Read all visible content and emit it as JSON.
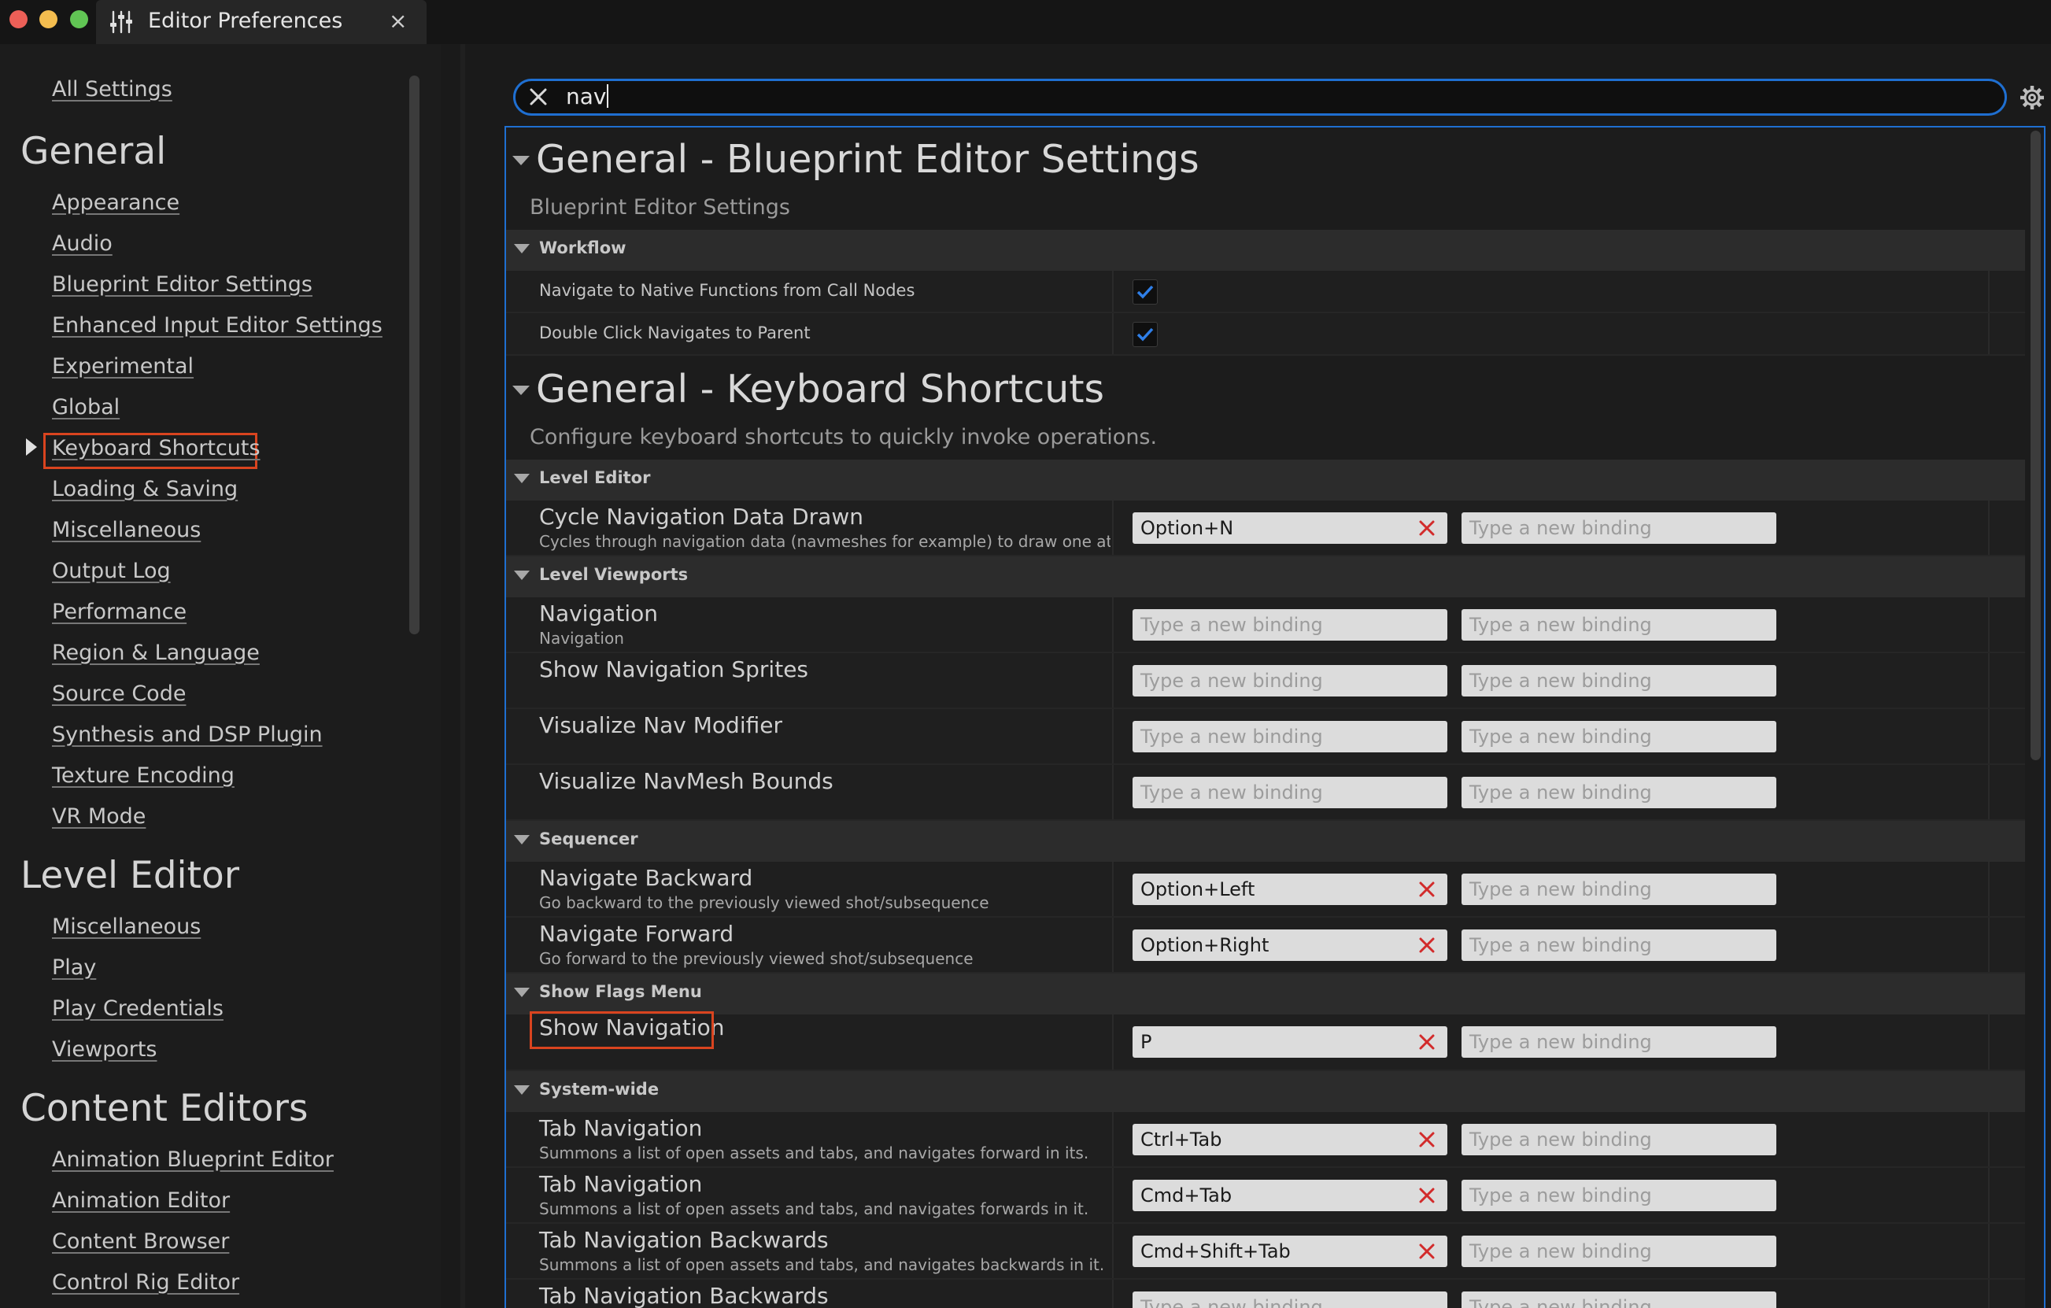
{
  "window": {
    "title": "Editor Preferences",
    "close_glyph": "×"
  },
  "search": {
    "value": "nav"
  },
  "sidebar": {
    "all_settings": "All Settings",
    "sections": [
      {
        "heading": "General",
        "items": [
          "Appearance",
          "Audio",
          "Blueprint Editor Settings",
          "Enhanced Input Editor Settings",
          "Experimental",
          "Global",
          "Keyboard Shortcuts",
          "Loading & Saving",
          "Miscellaneous",
          "Output Log",
          "Performance",
          "Region & Language",
          "Source Code",
          "Synthesis and DSP Plugin",
          "Texture Encoding",
          "VR Mode"
        ]
      },
      {
        "heading": "Level Editor",
        "items": [
          "Miscellaneous",
          "Play",
          "Play Credentials",
          "Viewports"
        ]
      },
      {
        "heading": "Content Editors",
        "items": [
          "Animation Blueprint Editor",
          "Animation Editor",
          "Content Browser",
          "Control Rig Editor"
        ]
      }
    ],
    "selected": "Keyboard Shortcuts"
  },
  "main": {
    "binding_placeholder": "Type a new binding",
    "sections": [
      {
        "title": "General - Blueprint Editor Settings",
        "subtitle": "Blueprint Editor Settings",
        "category": "Workflow",
        "rows": [
          {
            "name": "Navigate to Native Functions from Call Nodes",
            "checked": true
          },
          {
            "name": "Double Click Navigates to Parent",
            "checked": true
          }
        ]
      },
      {
        "title": "General - Keyboard Shortcuts",
        "subtitle": "Configure keyboard shortcuts to quickly invoke operations.",
        "categories": [
          {
            "name": "Level Editor",
            "rows": [
              {
                "name": "Cycle Navigation Data Drawn",
                "desc": "Cycles through navigation data (navmeshes for example) to draw one at a tim",
                "binding1": "Option+N"
              }
            ]
          },
          {
            "name": "Level Viewports",
            "rows": [
              {
                "name": "Navigation",
                "desc": "Navigation",
                "binding1": ""
              },
              {
                "name": "Show Navigation Sprites",
                "desc": "",
                "binding1": ""
              },
              {
                "name": "Visualize Nav Modifier",
                "desc": "",
                "binding1": ""
              },
              {
                "name": "Visualize NavMesh Bounds",
                "desc": "",
                "binding1": ""
              }
            ]
          },
          {
            "name": "Sequencer",
            "rows": [
              {
                "name": "Navigate Backward",
                "desc": "Go backward to the previously viewed shot/subsequence",
                "binding1": "Option+Left"
              },
              {
                "name": "Navigate Forward",
                "desc": "Go forward to the previously viewed shot/subsequence",
                "binding1": "Option+Right"
              }
            ]
          },
          {
            "name": "Show Flags Menu",
            "rows": [
              {
                "name": "Show Navigation",
                "desc": "",
                "binding1": "P"
              }
            ]
          },
          {
            "name": "System-wide",
            "rows": [
              {
                "name": "Tab Navigation",
                "desc": "Summons a list of open assets and tabs, and navigates forward in its.",
                "binding1": "Ctrl+Tab"
              },
              {
                "name": "Tab Navigation",
                "desc": "Summons a list of open assets and tabs, and navigates forwards in it.",
                "binding1": "Cmd+Tab"
              },
              {
                "name": "Tab Navigation Backwards",
                "desc": "Summons a list of open assets and tabs, and navigates backwards in it.",
                "binding1": "Cmd+Shift+Tab"
              },
              {
                "name": "Tab Navigation Backwards",
                "desc": "",
                "binding1": ""
              }
            ]
          }
        ]
      }
    ]
  },
  "colors": {
    "accent": "#1f6fd1",
    "highlight": "#d9441f",
    "remove": "#d22b2b"
  },
  "icons": {
    "window_tab": "sliders-icon",
    "search_clear": "close-icon",
    "settings": "gear-icon",
    "binding_remove": "close-icon",
    "checkbox": "checkmark-icon"
  }
}
